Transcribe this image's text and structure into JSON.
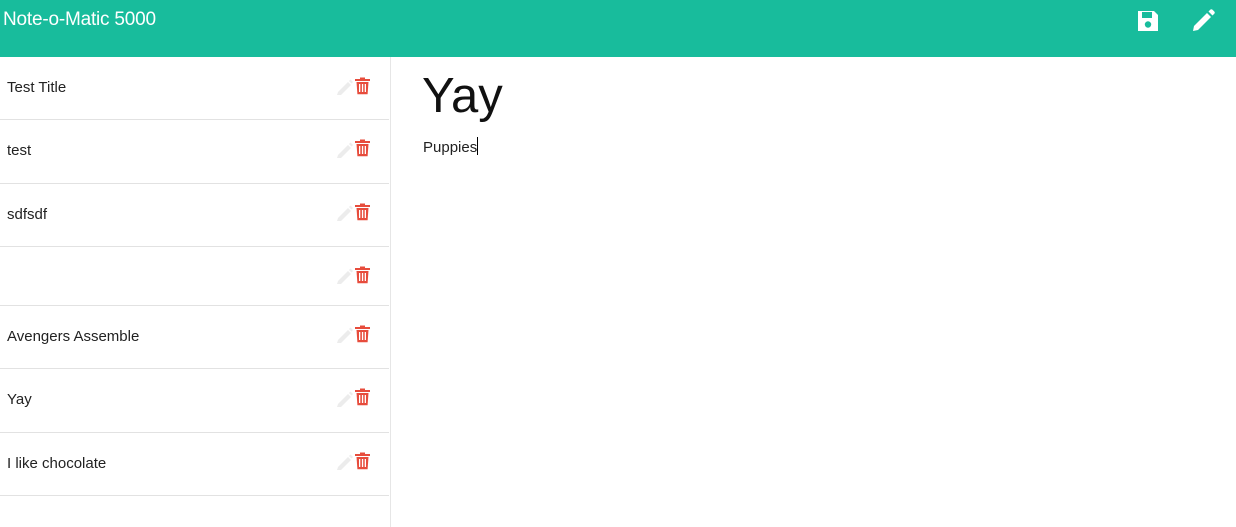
{
  "app": {
    "brand": "Note-o-Matic 5000",
    "accent_color": "#18bc9c",
    "delete_color": "#e74c3c"
  },
  "toolbar": {
    "save_icon": "floppy-disk-icon",
    "new_note_icon": "pencil-icon"
  },
  "notes": [
    {
      "title": "Test Title"
    },
    {
      "title": "test"
    },
    {
      "title": "sdfsdf"
    },
    {
      "title": ""
    },
    {
      "title": "Avengers Assemble"
    },
    {
      "title": "Yay"
    },
    {
      "title": "I like chocolate"
    }
  ],
  "active_note": {
    "title": "Yay",
    "text": "Puppies"
  }
}
